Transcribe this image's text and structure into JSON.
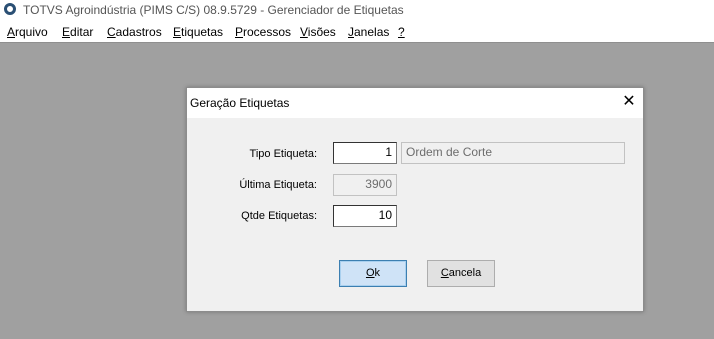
{
  "window": {
    "title": "TOTVS Agroindústria (PIMS C/S) 08.9.5729 - Gerenciador de Etiquetas"
  },
  "menu": {
    "items": [
      {
        "mnemonic": "A",
        "rest": "rquivo"
      },
      {
        "mnemonic": "E",
        "rest": "ditar"
      },
      {
        "mnemonic": "C",
        "rest": "adastros"
      },
      {
        "mnemonic": "E",
        "rest": "tiquetas"
      },
      {
        "mnemonic": "P",
        "rest": "rocessos"
      },
      {
        "mnemonic": "V",
        "rest": "isões"
      },
      {
        "mnemonic": "J",
        "rest": "anelas"
      },
      {
        "mnemonic": "?",
        "rest": ""
      }
    ]
  },
  "dialog": {
    "title": "Geração Etiquetas",
    "close_glyph": "✕",
    "tipo_label": "Tipo Etiqueta:",
    "tipo_value": "1",
    "tipo_desc": "Ordem de Corte",
    "ultima_label": "Última Etiqueta:",
    "ultima_value": "3900",
    "qtde_label": "Qtde Etiquetas:",
    "qtde_value": "10",
    "ok_mnemonic": "O",
    "ok_rest": "k",
    "cancel_mnemonic": "C",
    "cancel_rest": "ancela"
  }
}
